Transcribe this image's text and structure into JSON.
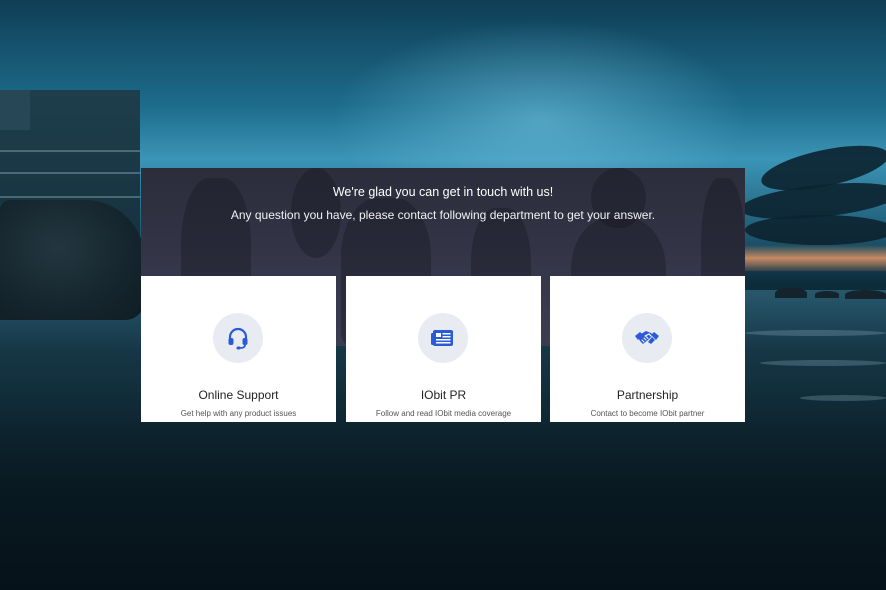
{
  "hero": {
    "title": "We're glad you can get in touch with us!",
    "subtitle": "Any question you have, please contact following department to get your answer."
  },
  "cards": [
    {
      "title": "Online Support",
      "description": "Get help with any product issues",
      "icon": "headset-icon"
    },
    {
      "title": "IObit PR",
      "description": "Follow and read IObit media coverage",
      "icon": "newspaper-icon"
    },
    {
      "title": "Partnership",
      "description": "Contact to become IObit partner",
      "icon": "handshake-icon"
    }
  ],
  "colors": {
    "accent": "#2a5bd7",
    "icon_bg": "#e9ebf2",
    "hero_bg": "#34364a"
  }
}
